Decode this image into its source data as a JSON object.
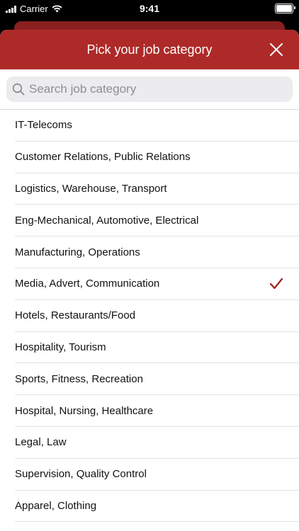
{
  "status_bar": {
    "carrier": "Carrier",
    "time": "9:41",
    "battery_level": 1.0,
    "icons": [
      "signal-icon",
      "wifi-icon",
      "battery-icon"
    ]
  },
  "header": {
    "title": "Pick your job category",
    "close_icon": "close-icon",
    "background": "#ad2a28"
  },
  "search": {
    "placeholder": "Search job category",
    "value": ""
  },
  "categories": [
    {
      "label": "IT-Telecoms",
      "selected": false
    },
    {
      "label": "Customer Relations, Public Relations",
      "selected": false
    },
    {
      "label": "Logistics, Warehouse, Transport",
      "selected": false
    },
    {
      "label": "Eng-Mechanical, Automotive, Electrical",
      "selected": false
    },
    {
      "label": "Manufacturing, Operations",
      "selected": false
    },
    {
      "label": "Media, Advert, Communication",
      "selected": true
    },
    {
      "label": "Hotels, Restaurants/Food",
      "selected": false
    },
    {
      "label": "Hospitality, Tourism",
      "selected": false
    },
    {
      "label": "Sports, Fitness, Recreation",
      "selected": false
    },
    {
      "label": "Hospital, Nursing, Healthcare",
      "selected": false
    },
    {
      "label": "Legal, Law",
      "selected": false
    },
    {
      "label": "Supervision, Quality Control",
      "selected": false
    },
    {
      "label": "Apparel, Clothing",
      "selected": false
    }
  ],
  "colors": {
    "accent": "#ad2a28",
    "check": "#9e1b1b"
  }
}
